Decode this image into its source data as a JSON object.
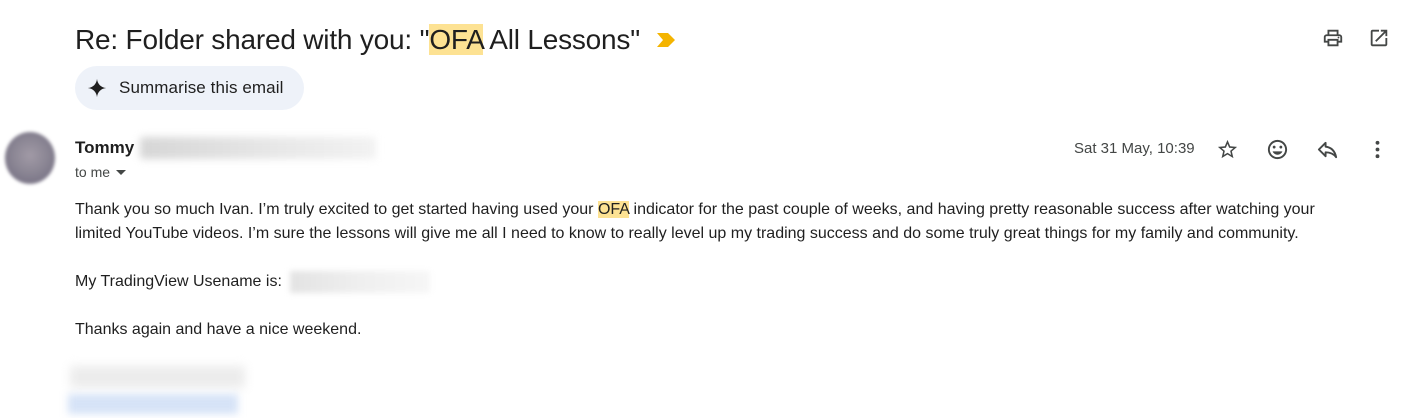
{
  "subject": {
    "prefix": "Re: Folder shared with you: \"",
    "highlight": "OFA",
    "suffix": " All Lessons\""
  },
  "summarise": {
    "label": "Summarise this email"
  },
  "sender": {
    "name": "Tommy",
    "to_label": "to me"
  },
  "date": "Sat 31 May, 10:39",
  "body": {
    "p1_before": "Thank you so much Ivan.  I’m truly excited to get started having used your ",
    "p1_highlight": "OFA",
    "p1_after": " indicator for the past couple of weeks, and having pretty reasonable success after watching your limited YouTube videos.  I’m sure the lessons will give me all I need to know to really level up my trading success and do some truly great things for my family and community.",
    "p2": "My TradingView Usename is:",
    "p3": "Thanks again and have a nice weekend."
  },
  "colors": {
    "highlight": "#fde293",
    "important_marker": "#f4b400",
    "summarise_bg": "#eef2f9"
  },
  "icons": [
    "sparkle-icon",
    "print-icon",
    "open-in-new-icon",
    "star-icon",
    "emoji-icon",
    "reply-icon",
    "more-vert-icon",
    "important-marker-icon"
  ]
}
